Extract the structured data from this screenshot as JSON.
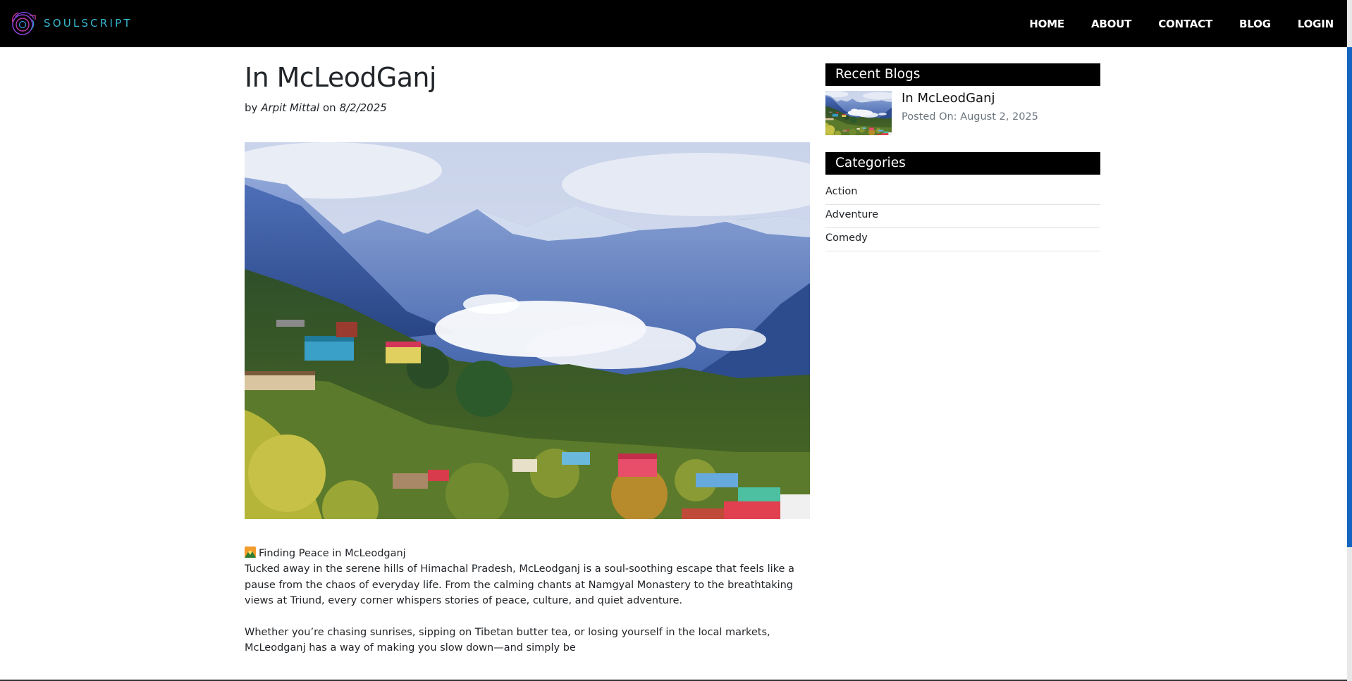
{
  "header": {
    "brand_name": "SOULSCRIPT",
    "nav": [
      {
        "label": "HOME"
      },
      {
        "label": "ABOUT"
      },
      {
        "label": "CONTACT"
      },
      {
        "label": "BLOG"
      },
      {
        "label": "LOGIN"
      }
    ]
  },
  "post": {
    "title": "In McLeodGanj",
    "by_prefix": "by",
    "author": "Arpit Mittal",
    "on_word": "on",
    "date": "8/2/2025",
    "image_icon": "mountain-landscape-photo",
    "paragraphs": [
      {
        "emoji": "sunrise-over-mountains-emoji",
        "text": "Finding Peace in McLeodganj"
      },
      {
        "text": "Tucked away in the serene hills of Himachal Pradesh, McLeodganj is a soul-soothing escape that feels like a pause from the chaos of everyday life. From the calming chants at Namgyal Monastery to the breathtaking views at Triund, every corner whispers stories of peace, culture, and quiet adventure."
      },
      {
        "text": "Whether you’re chasing sunrises, sipping on Tibetan butter tea, or losing yourself in the local markets, McLeodganj has a way of making you slow down—and simply be"
      }
    ]
  },
  "sidebar": {
    "recent_heading": "Recent Blogs",
    "recent": [
      {
        "title": "In McLeodGanj",
        "posted": "Posted On: August 2, 2025"
      }
    ],
    "categories_heading": "Categories",
    "categories": [
      {
        "label": "Action"
      },
      {
        "label": "Adventure"
      },
      {
        "label": "Comedy"
      }
    ]
  },
  "colors": {
    "navbar_bg": "#000000",
    "brand_text": "#36b6cf",
    "sidebar_heading_bg": "#000000",
    "scroll_thumb": "#1565c0"
  }
}
